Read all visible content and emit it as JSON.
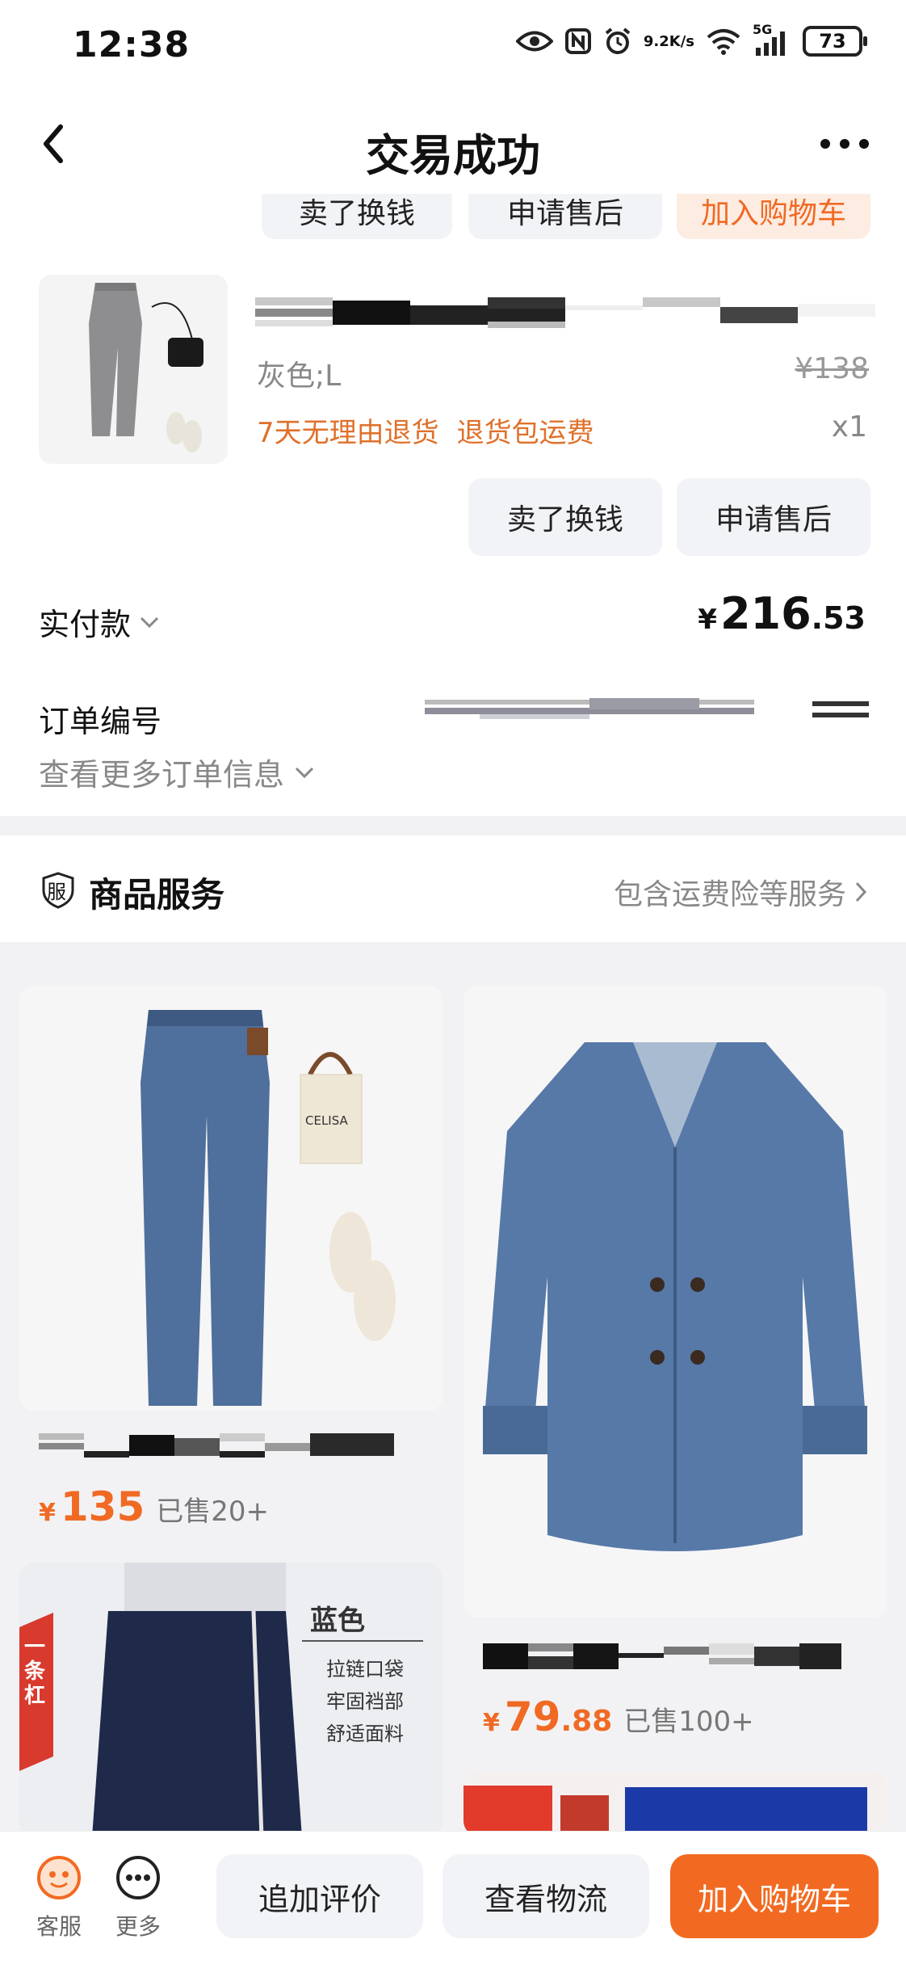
{
  "status_bar": {
    "time": "12:38",
    "net_speed_top": "9.2",
    "net_speed_bottom": "K/s",
    "signal": "5G",
    "battery": "73",
    "icons": [
      "eye-icon",
      "nfc-icon",
      "alarm-icon",
      "wifi-icon",
      "signal-icon",
      "battery-icon"
    ]
  },
  "header": {
    "title": "交易成功",
    "back_icon": "chevron-left-icon",
    "more_icon": "more-horizontal-icon"
  },
  "top_actions": {
    "sell_label": "卖了换钱",
    "after_sale_label": "申请售后",
    "add_cart_label": "加入购物车"
  },
  "order_item": {
    "variant": "灰色;L",
    "original_price": "¥138",
    "tag_return": "7天无理由退货",
    "tag_shipping": "退货包运费",
    "quantity": "x1",
    "sell_label": "卖了换钱",
    "after_sale_label": "申请售后"
  },
  "payment": {
    "label": "实付款",
    "currency": "¥",
    "amount_int": "216",
    "amount_dec": ".53"
  },
  "order_info": {
    "order_no_label": "订单编号",
    "more_info_label": "查看更多订单信息"
  },
  "service": {
    "badge": "服",
    "title": "商品服务",
    "link": "包含运费险等服务"
  },
  "recommendations": [
    {
      "currency": "¥",
      "price_int": "135",
      "price_dec": "",
      "sold": "已售20+",
      "bag_text": "CELISA"
    },
    {
      "currency": "¥",
      "price_int": "79",
      "price_dec": ".88",
      "sold": "已售100+"
    },
    {
      "ad_vertical": "一条杠",
      "ad_title": "蓝色",
      "ad_lines": [
        "拉链口袋",
        "牢固裆部",
        "舒适面料"
      ]
    }
  ],
  "bottom_bar": {
    "service_label": "客服",
    "more_label": "更多",
    "review_label": "追加评价",
    "logistics_label": "查看物流",
    "add_cart_label": "加入购物车"
  },
  "colors": {
    "accent": "#f26a21",
    "tag_orange": "#e0702a",
    "muted": "#888888"
  }
}
